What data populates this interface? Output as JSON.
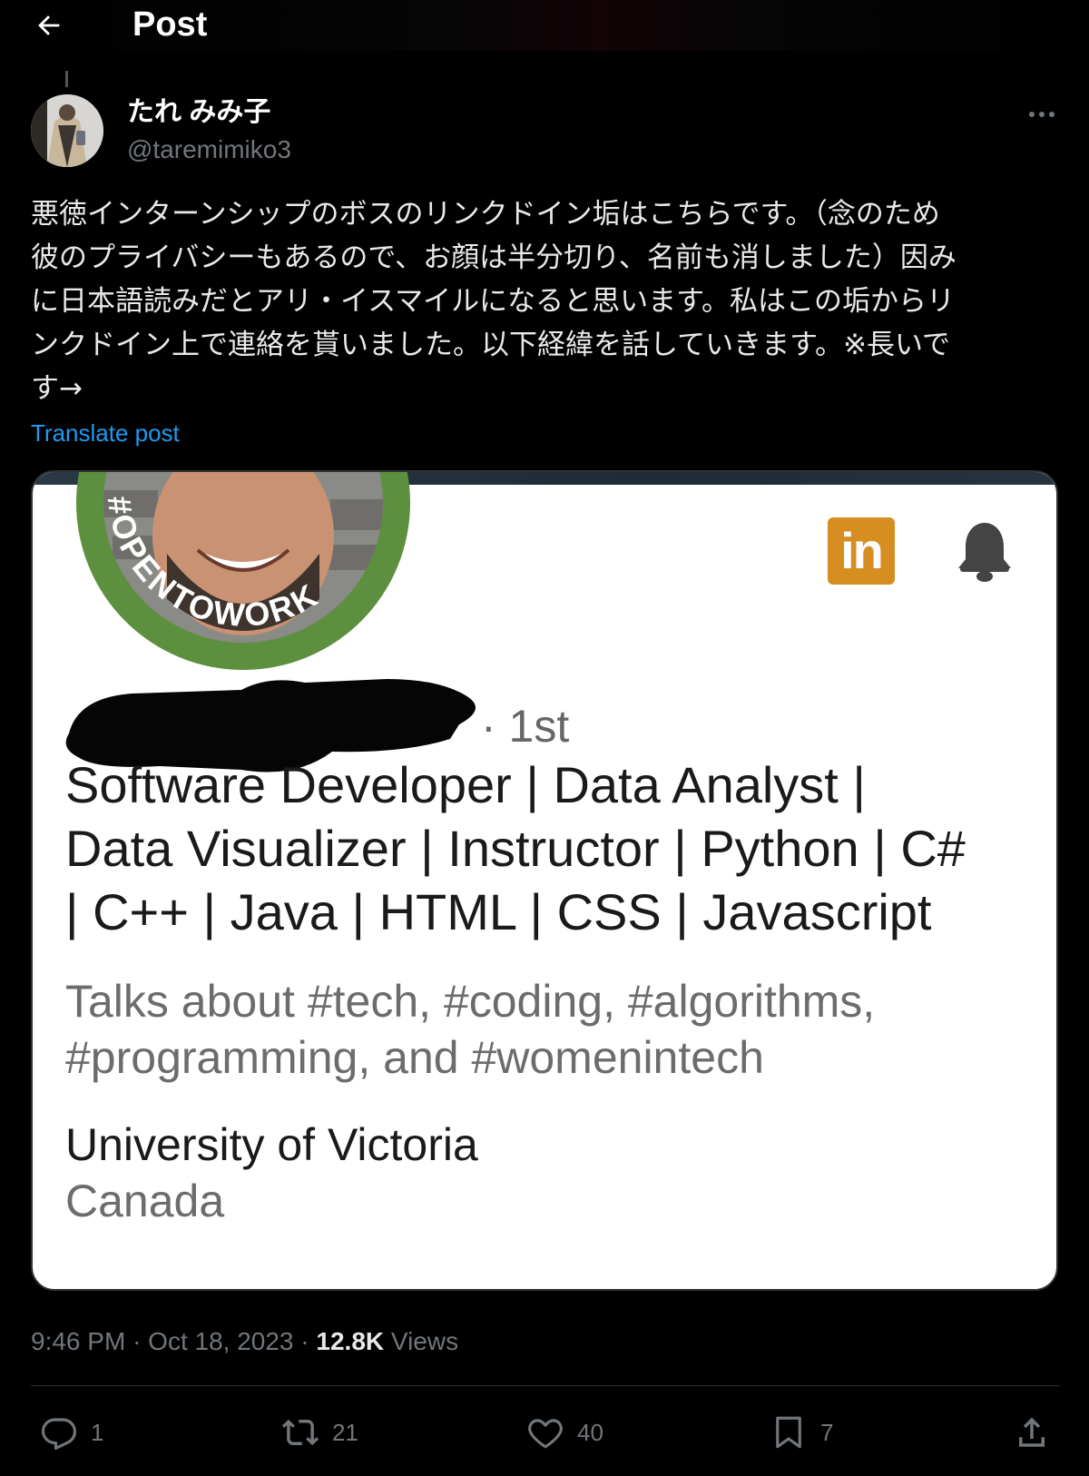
{
  "header": {
    "title": "Post",
    "back_icon": "arrow-left-icon"
  },
  "author": {
    "display_name": "たれ みみ子",
    "handle": "@taremimiko3"
  },
  "post": {
    "text_lines": [
      "悪徳インターンシップのボスのリンクドイン垢はこちらです。（念のため",
      "彼のプライバシーもあるので、お顔は半分切り、名前も消しました）因み",
      "に日本語読みだとアリ・イスマイルになると思います。私はこの垢からリ",
      "ンクドイン上で連絡を貰いました。以下経緯を話していきます。※長いで",
      "す→"
    ],
    "translate_label": "Translate post"
  },
  "media": {
    "ring_text": "#OPENTOWORK",
    "linkedin_logo": "in",
    "degree": "· 1st",
    "headline_lines": [
      "Software Developer | Data Analyst |",
      "Data Visualizer | Instructor | Python | C#",
      "| C++ | Java | HTML | CSS | Javascript"
    ],
    "talks_lines": [
      "Talks about #tech, #coding, #algorithms,",
      "#programming, and #womenintech"
    ],
    "school": "University of Victoria",
    "country": "Canada",
    "colors": {
      "ring": "#5c8f3e",
      "linkedin": "#d68e20"
    }
  },
  "meta": {
    "time": "9:46 PM",
    "date": "Oct 18, 2023",
    "sep": "·",
    "views_count": "12.8K",
    "views_label": "Views"
  },
  "actions": {
    "reply": {
      "count": "1",
      "icon": "reply-icon"
    },
    "repost": {
      "count": "21",
      "icon": "repost-icon"
    },
    "like": {
      "count": "40",
      "icon": "heart-icon"
    },
    "bookmark": {
      "count": "7",
      "icon": "bookmark-icon"
    },
    "share": {
      "icon": "share-icon"
    }
  }
}
